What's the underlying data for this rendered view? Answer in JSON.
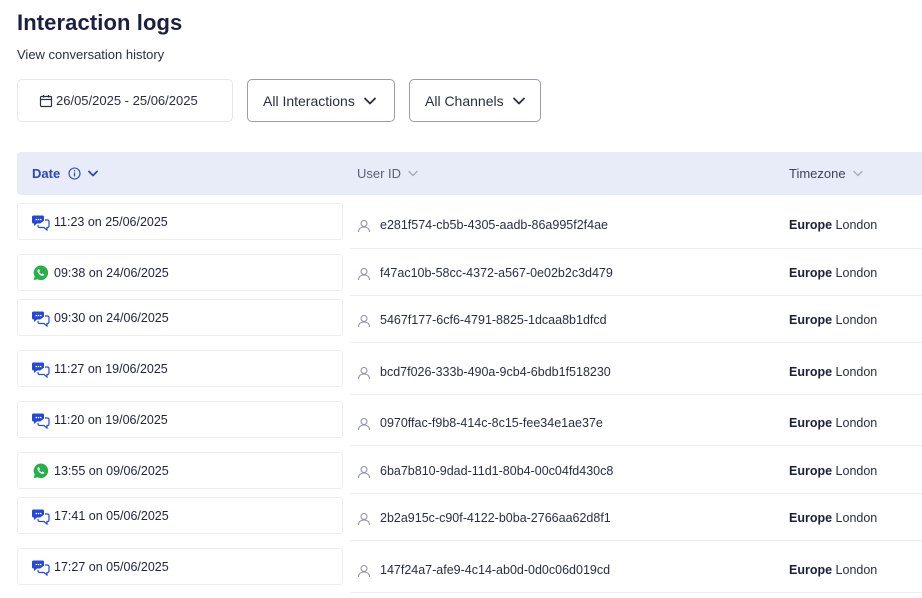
{
  "header": {
    "title": "Interaction logs",
    "subtitle": "View conversation history"
  },
  "filters": {
    "date_range": "26/05/2025 - 25/06/2025",
    "interactions": "All Interactions",
    "channels": "All Channels"
  },
  "table": {
    "columns": {
      "date": "Date",
      "user_id": "User ID",
      "timezone": "Timezone"
    },
    "rows": [
      {
        "channel": "chat",
        "datetime": "11:23 on 25/06/2025",
        "user_id": "e281f574-cb5b-4305-aadb-86a995f2f4ae",
        "tz_region": "Europe",
        "tz_city": "London"
      },
      {
        "channel": "whatsapp",
        "datetime": "09:38 on 24/06/2025",
        "user_id": "f47ac10b-58cc-4372-a567-0e02b2c3d479",
        "tz_region": "Europe",
        "tz_city": "London"
      },
      {
        "channel": "chat",
        "datetime": "09:30 on 24/06/2025",
        "user_id": "5467f177-6cf6-4791-8825-1dcaa8b1dfcd",
        "tz_region": "Europe",
        "tz_city": "London"
      },
      {
        "channel": "chat",
        "datetime": "11:27 on 19/06/2025",
        "user_id": "bcd7f026-333b-490a-9cb4-6bdb1f518230",
        "tz_region": "Europe",
        "tz_city": "London"
      },
      {
        "channel": "chat",
        "datetime": "11:20 on 19/06/2025",
        "user_id": "0970ffac-f9b8-414c-8c15-fee34e1ae37e",
        "tz_region": "Europe",
        "tz_city": "London"
      },
      {
        "channel": "whatsapp",
        "datetime": "13:55 on 09/06/2025",
        "user_id": "6ba7b810-9dad-11d1-80b4-00c04fd430c8",
        "tz_region": "Europe",
        "tz_city": "London"
      },
      {
        "channel": "chat",
        "datetime": "17:41 on 05/06/2025",
        "user_id": "2b2a915c-c90f-4122-b0ba-2766aa62d8f1",
        "tz_region": "Europe",
        "tz_city": "London"
      },
      {
        "channel": "chat",
        "datetime": "17:27 on 05/06/2025",
        "user_id": "147f24a7-afe9-4c14-ab0d-0d0c06d019cd",
        "tz_region": "Europe",
        "tz_city": "London"
      }
    ]
  },
  "colors": {
    "header_bg": "#e8ecf8",
    "accent": "#2b47b5",
    "chat_icon": "#2548d8",
    "whatsapp_icon": "#25b14a"
  },
  "icons": {
    "date_filter": "calendar-icon",
    "dropdown": "chevron-down-icon",
    "info": "info-icon",
    "user": "user-icon",
    "chat_channel": "chat-bubbles-icon",
    "whatsapp_channel": "whatsapp-icon"
  }
}
